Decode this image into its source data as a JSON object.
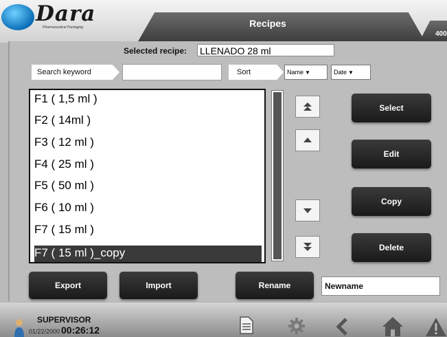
{
  "header": {
    "logo_text": "Dara",
    "logo_sub": "Pharmaceutical Packaging",
    "title": "Recipes",
    "corner_number": "400"
  },
  "recipe": {
    "selected_label": "Selected recipe:",
    "selected_value": "LLENADO 28 ml"
  },
  "search": {
    "label": "Search keyword",
    "value": ""
  },
  "sort": {
    "label": "Sort",
    "by_name": "Name",
    "by_date": "Date"
  },
  "list": {
    "items": [
      "F1 ( 1,5 ml )",
      "F2 ( 14ml )",
      "F3 ( 12 ml )",
      "F4 ( 25 ml )",
      "F5 ( 50 ml )",
      "F6 ( 10 ml )",
      "F7 ( 15 ml )",
      "F7 ( 15 ml )_copy"
    ],
    "selected_index": 7
  },
  "nav_icons": [
    "double-up-arrow-icon",
    "up-arrow-icon",
    "down-arrow-icon",
    "double-down-arrow-icon"
  ],
  "actions": {
    "select": "Select",
    "edit": "Edit",
    "copy": "Copy",
    "delete": "Delete",
    "export": "Export",
    "import": "Import",
    "rename": "Rename"
  },
  "rename_field": {
    "value": "Newname"
  },
  "footer": {
    "user": "SUPERVISOR",
    "date": "01/22/2000",
    "time": "00:26:12",
    "icons": [
      "document-icon",
      "gear-icon",
      "back-icon",
      "home-icon",
      "warning-icon"
    ]
  },
  "colors": {
    "accent_blue": "#0a6fb8",
    "button_dark": "#2a2a2a",
    "selection": "#3a3a3a"
  }
}
